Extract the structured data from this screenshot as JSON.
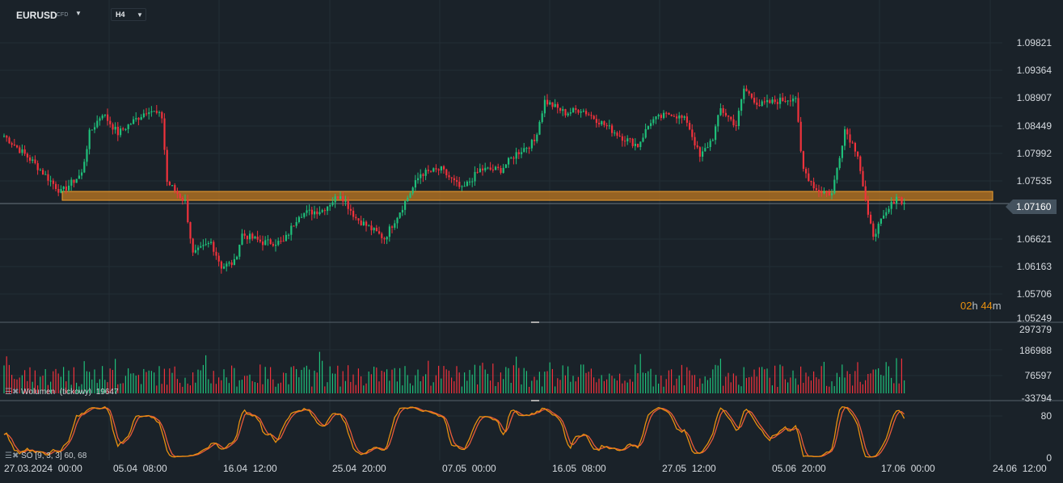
{
  "toolbar": {
    "symbol": "EURUSD",
    "symbol_type": "CFD",
    "timeframe": "H4"
  },
  "price_axis": [
    "1.09821",
    "1.09364",
    "1.08907",
    "1.08449",
    "1.07992",
    "1.07535",
    "1.06621",
    "1.06163",
    "1.05706",
    "1.05249"
  ],
  "current_price": "1.07160",
  "countdown": {
    "hours": "02",
    "h": "h",
    "minutes": "44",
    "m": "m"
  },
  "volume_axis": [
    "297379",
    "186988",
    "76597",
    "-33794"
  ],
  "volume_label": "Wolumen  (tickowy)  19647",
  "so_axis": [
    "80",
    "0"
  ],
  "so_label": "SO [9, 3, 3] 60, 68",
  "date_axis": [
    "27.03.2024  00:00",
    "05.04  08:00",
    "16.04  12:00",
    "25.04  20:00",
    "07.05  00:00",
    "16.05  08:00",
    "27.05  12:00",
    "05.06  20:00",
    "17.06  00:00",
    "24.06  12:00"
  ],
  "colors": {
    "up": "#1fbf7a",
    "down": "#f0323c",
    "zone": "#c07a22",
    "so_k": "#e8900f",
    "so_d": "#e85a3a"
  },
  "chart_data": {
    "type": "candlestick",
    "timeframe": "H4",
    "price_range": [
      1.05249,
      1.09821
    ],
    "close_path_bar_price": [
      [
        0,
        1.08283
      ],
      [
        11,
        1.07856
      ],
      [
        22,
        1.07348
      ],
      [
        30,
        1.07655
      ],
      [
        33,
        1.08324
      ],
      [
        38,
        1.08658
      ],
      [
        44,
        1.08324
      ],
      [
        50,
        1.08524
      ],
      [
        56,
        1.08725
      ],
      [
        61,
        1.08591
      ],
      [
        63,
        1.07521
      ],
      [
        70,
        1.07187
      ],
      [
        73,
        1.06318
      ],
      [
        80,
        1.06519
      ],
      [
        84,
        1.06118
      ],
      [
        89,
        1.06184
      ],
      [
        92,
        1.06652
      ],
      [
        100,
        1.06519
      ],
      [
        108,
        1.06519
      ],
      [
        114,
        1.06987
      ],
      [
        123,
        1.07053
      ],
      [
        130,
        1.07321
      ],
      [
        136,
        1.0692
      ],
      [
        147,
        1.06585
      ],
      [
        155,
        1.07187
      ],
      [
        161,
        1.07655
      ],
      [
        169,
        1.07722
      ],
      [
        177,
        1.07388
      ],
      [
        184,
        1.07722
      ],
      [
        192,
        1.07722
      ],
      [
        198,
        1.07989
      ],
      [
        205,
        1.0819
      ],
      [
        209,
        1.08858
      ],
      [
        217,
        1.08658
      ],
      [
        223,
        1.08725
      ],
      [
        230,
        1.08524
      ],
      [
        239,
        1.08257
      ],
      [
        245,
        1.08123
      ],
      [
        250,
        1.08524
      ],
      [
        258,
        1.08658
      ],
      [
        264,
        1.08524
      ],
      [
        269,
        1.07922
      ],
      [
        274,
        1.08257
      ],
      [
        277,
        1.08725
      ],
      [
        283,
        1.08457
      ],
      [
        286,
        1.09059
      ],
      [
        292,
        1.08791
      ],
      [
        299,
        1.08858
      ],
      [
        306,
        1.08925
      ],
      [
        308,
        1.07989
      ],
      [
        309,
        1.07722
      ],
      [
        314,
        1.07388
      ],
      [
        320,
        1.07321
      ],
      [
        325,
        1.0839
      ],
      [
        330,
        1.07989
      ],
      [
        334,
        1.0692
      ],
      [
        336,
        1.06652
      ],
      [
        341,
        1.06987
      ],
      [
        345,
        1.07294
      ],
      [
        348,
        1.0716
      ]
    ],
    "support_zone": {
      "top": 1.07361,
      "bottom": 1.07214
    }
  }
}
